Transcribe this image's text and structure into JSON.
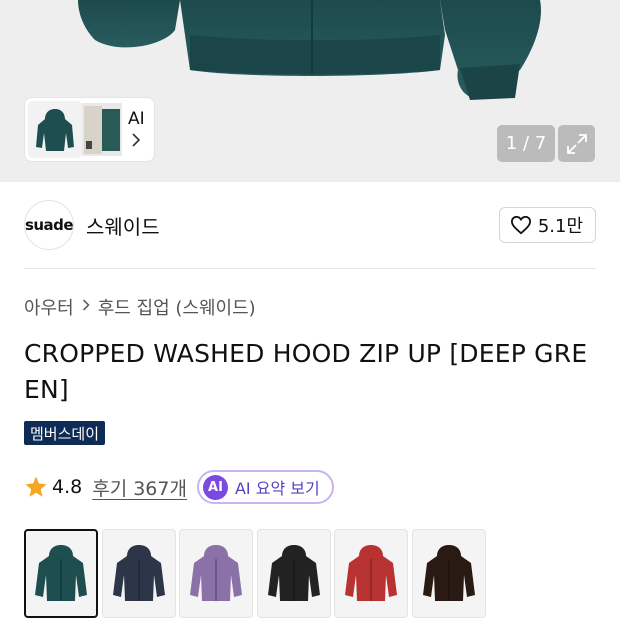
{
  "gallery": {
    "thumb_ai_label": "AI",
    "counter": "1 / 7",
    "product_color": "#1f4f52"
  },
  "brand": {
    "logo_text": "suade",
    "name": "스웨이드",
    "likes": "5.1만"
  },
  "breadcrumb": {
    "items": [
      "아우터",
      "후드 집업 (스웨이드)"
    ]
  },
  "product": {
    "title": "CROPPED WASHED HOOD ZIP UP [DEEP GREEN]",
    "badge": "멤버스데이"
  },
  "rating": {
    "score": "4.8",
    "reviews": "후기 367개",
    "ai_icon": "AI",
    "ai_summary": "AI 요약 보기",
    "star_color": "#f5a623"
  },
  "swatches": [
    {
      "color": "#1e4e50",
      "name": "deep-green"
    },
    {
      "color": "#2d3548",
      "name": "navy"
    },
    {
      "color": "#8a72a8",
      "name": "purple"
    },
    {
      "color": "#222222",
      "name": "black"
    },
    {
      "color": "#b83232",
      "name": "red"
    },
    {
      "color": "#2a1a14",
      "name": "brown"
    }
  ]
}
